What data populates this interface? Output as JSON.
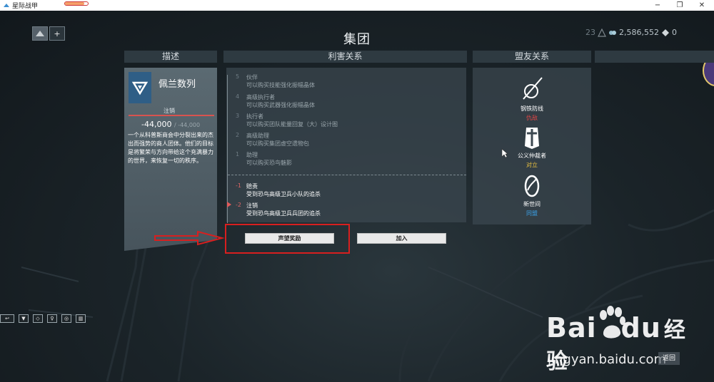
{
  "window": {
    "title": "星际战甲",
    "progress_fraction": 0.85,
    "minimize": "−",
    "maximize": "❐",
    "close": "✕"
  },
  "hud": {
    "title": "集团",
    "plus_label": "+",
    "mastery_rank": "23",
    "credits": "2,586,552",
    "platinum": "0"
  },
  "columns": {
    "description": "描述",
    "relations": "利害关系",
    "allies": "盟友关系"
  },
  "faction": {
    "name": "佩兰数列",
    "rank": "注销",
    "standing": "-44,000",
    "standing_max": "/ -44,000",
    "description": "一个从科普斯商会中分裂出来的杰出而强势的商人团体。他们的目标是将繁荣与方向带给这个充满暴力的世界，来恢复一切的秩序。"
  },
  "ranks": [
    {
      "num": "5",
      "name": "伙伴",
      "desc": "可以购买技能强化振幅晶体",
      "negative": false
    },
    {
      "num": "4",
      "name": "高级执行者",
      "desc": "可以购买武器强化振幅晶体",
      "negative": false
    },
    {
      "num": "3",
      "name": "执行者",
      "desc": "可以购买团队能量回复（大）设计图",
      "negative": false
    },
    {
      "num": "2",
      "name": "高级助理",
      "desc": "可以购买集团虚空遗物包",
      "negative": false
    },
    {
      "num": "1",
      "name": "助理",
      "desc": "可以购买恐鸟魅影",
      "negative": false
    },
    {
      "num": "-1",
      "name": "赔责",
      "desc": "受到恐鸟高级卫兵小队的追杀",
      "negative": true
    },
    {
      "num": "-2",
      "name": "注销",
      "desc": "受到恐鸟高级卫兵兵团的追杀",
      "negative": true
    }
  ],
  "buttons": {
    "rewards": "声望奖励",
    "join": "加入",
    "back": "返回"
  },
  "allies": [
    {
      "name": "钢铁防线",
      "status": "仇敌",
      "status_color": "#e04545",
      "icon": "steel-meridian-icon"
    },
    {
      "name": "公义仲裁者",
      "status": "对立",
      "status_color": "#e8c040",
      "icon": "arbiters-of-hexis-icon"
    },
    {
      "name": "新世间",
      "status": "同盟",
      "status_color": "#3aa0e6",
      "icon": "new-loka-icon"
    }
  ],
  "bottom_bar": [
    "↩",
    "▼",
    "◇",
    "♀",
    "◎",
    "▥"
  ],
  "watermark": {
    "brand_left": "Bai",
    "brand_right": "du",
    "brand_cn": "经验",
    "url": "jingyan.baidu.com"
  }
}
